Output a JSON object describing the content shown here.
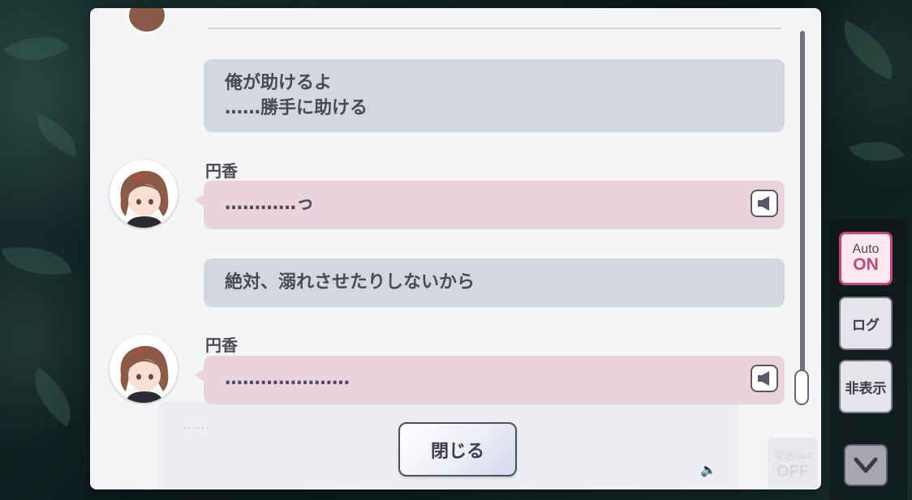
{
  "log": {
    "messages": [
      {
        "type": "narration",
        "text": "俺が助けるよ\n……勝手に助ける"
      },
      {
        "type": "character",
        "speaker": "円香",
        "text": "…………っ"
      },
      {
        "type": "narration",
        "text": "絶対、溺れさせたりしないから"
      },
      {
        "type": "character",
        "speaker": "円香",
        "text": "…………………"
      }
    ],
    "close_label": "閉じる",
    "voice_icon": "speaker-icon"
  },
  "background_ui": {
    "dots": "……",
    "speed_line1": "早送0x4",
    "speed_line2": "OFF"
  },
  "side_controls": {
    "auto_label": "Auto",
    "auto_state": "ON",
    "log_label": "ログ",
    "hide_label": "非表示",
    "down_icon": "chevron-down-icon"
  },
  "colors": {
    "narration_bubble": "#d3d8e0",
    "character_bubble": "#ead3dc",
    "auto_accent": "#c7457a"
  }
}
